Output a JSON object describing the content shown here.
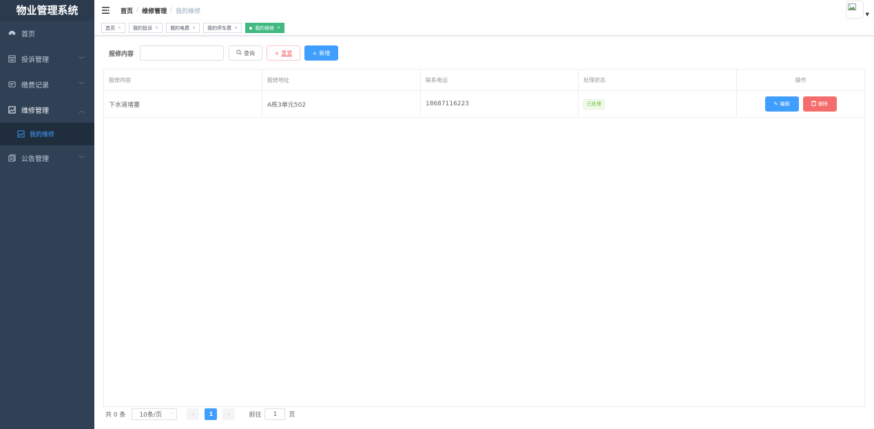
{
  "app": {
    "title": "物业管理系统"
  },
  "sidebar": {
    "items": [
      {
        "label": "首页",
        "icon": "dashboard-icon"
      },
      {
        "label": "投诉管理",
        "icon": "complaint-icon"
      },
      {
        "label": "缴费记录",
        "icon": "payment-icon"
      },
      {
        "label": "维修管理",
        "icon": "repair-icon"
      },
      {
        "label": "公告管理",
        "icon": "notice-icon"
      }
    ],
    "submenu": {
      "label": "我的维修",
      "icon": "picture-icon"
    }
  },
  "breadcrumb": {
    "items": [
      "首页",
      "维修管理",
      "我的维修"
    ],
    "separator": "/"
  },
  "tags": [
    {
      "label": "首页"
    },
    {
      "label": "我的投诉"
    },
    {
      "label": "我的电费"
    },
    {
      "label": "我的停车费"
    },
    {
      "label": "我的维修",
      "active": true
    }
  ],
  "search": {
    "label": "报修内容",
    "input_value": "",
    "search_label": "查询",
    "reset_label": "重置",
    "add_label": "新增"
  },
  "table": {
    "columns": [
      "报修内容",
      "报修地址",
      "联系电话",
      "处理状态",
      "操作"
    ],
    "rows": [
      {
        "content": "下水道堵塞",
        "address": "A栋3单元502",
        "phone": "18687116223",
        "status": "已处理"
      }
    ],
    "edit_label": "编辑",
    "delete_label": "删除"
  },
  "pagination": {
    "total": "共 0 条",
    "page_size": "10条/页",
    "current_page": "1",
    "goto_label": "前往",
    "goto_value": "1",
    "page_unit": "页"
  },
  "colors": {
    "sidebar_bg": "#304156",
    "primary": "#409eff",
    "danger": "#f56c6c",
    "active_tag": "#42b983",
    "success": "#67c23a"
  }
}
